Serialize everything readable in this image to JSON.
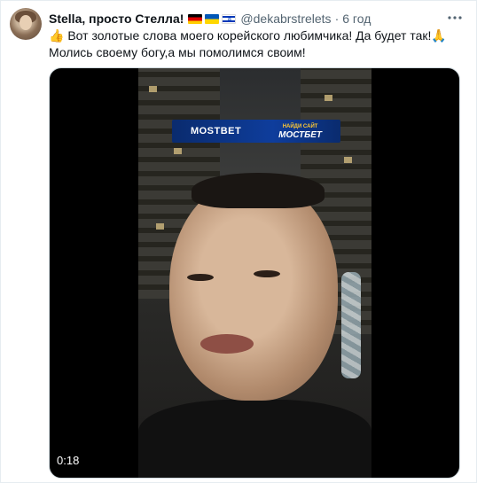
{
  "tweet": {
    "author_name": "Stella, просто Стелла!",
    "flag_icons": [
      "flag-germany",
      "flag-ukraine",
      "flag-israel"
    ],
    "handle": "@dekabrstrelets",
    "separator": "·",
    "time": "6 год",
    "more_icon": "more-icon",
    "text_line1": "Вот золотые слова моего корейского любимчика! Да будет так!",
    "text_line2": "Молись своему богу,а мы помолимся своим!",
    "emoji_lead": "👍",
    "emoji_trail": "🙏"
  },
  "video": {
    "duration": "0:18",
    "banner_logo": "MOSTBET",
    "banner_small": "НАЙДИ САЙТ",
    "banner_big": "МОСТБЕТ"
  },
  "colors": {
    "text": "#0f1419",
    "secondary": "#536471",
    "border": "#e6ecf0",
    "banner": "#0e3d9c"
  }
}
